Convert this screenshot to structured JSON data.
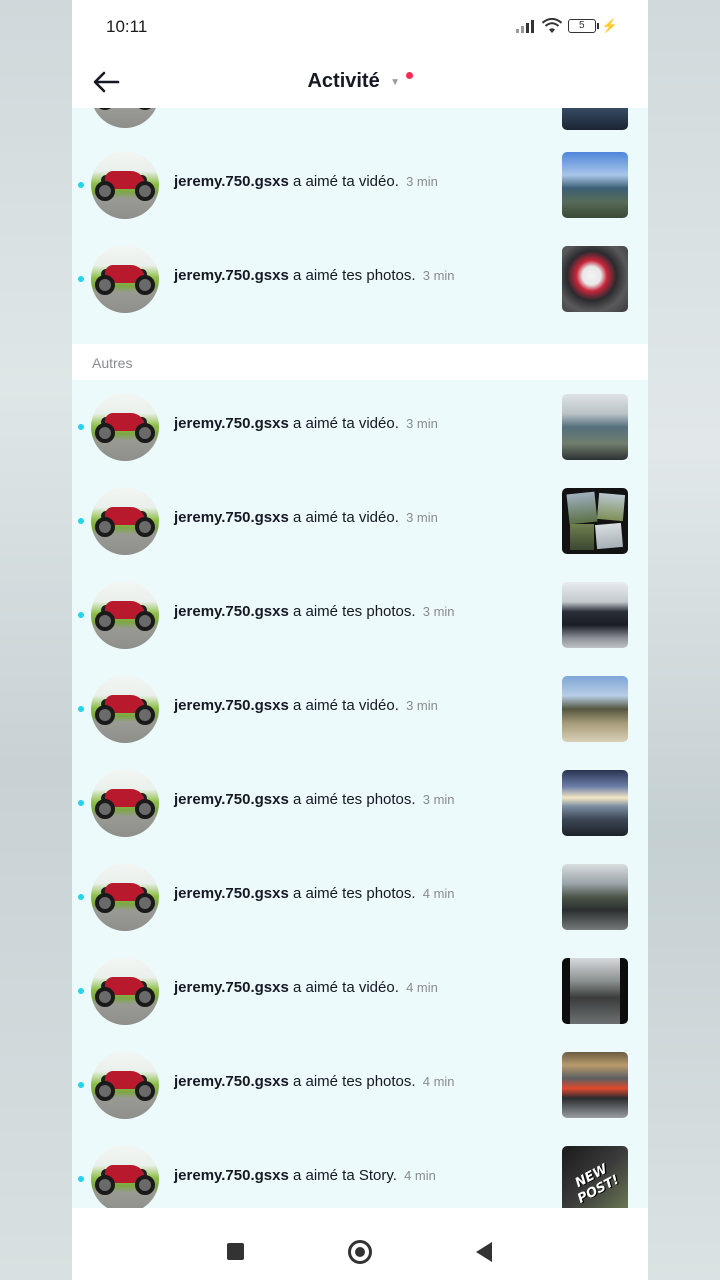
{
  "status_bar": {
    "time": "10:11",
    "battery": "5"
  },
  "header": {
    "title": "Activité"
  },
  "colors": {
    "unread_dot": "#20d5ec",
    "notification_dot": "#fe2c55",
    "section_bg": "#ecfafc",
    "muted_text": "#8a8b91"
  },
  "top_rows": [
    {
      "user": "jeremy.750.gsxs",
      "action": "a aimé ta vidéo.",
      "time": "3 min",
      "thumb": "lake-scene"
    },
    {
      "user": "jeremy.750.gsxs",
      "action": "a aimé tes photos.",
      "time": "3 min",
      "thumb": "white-motorcycle"
    }
  ],
  "section_label": "Autres",
  "other_rows": [
    {
      "user": "jeremy.750.gsxs",
      "action": "a aimé ta vidéo.",
      "time": "3 min",
      "thumb": "river-bike"
    },
    {
      "user": "jeremy.750.gsxs",
      "action": "a aimé ta vidéo.",
      "time": "3 min",
      "thumb": "collage"
    },
    {
      "user": "jeremy.750.gsxs",
      "action": "a aimé tes photos.",
      "time": "3 min",
      "thumb": "dark-car"
    },
    {
      "user": "jeremy.750.gsxs",
      "action": "a aimé ta vidéo.",
      "time": "3 min",
      "thumb": "field-bike"
    },
    {
      "user": "jeremy.750.gsxs",
      "action": "a aimé tes photos.",
      "time": "3 min",
      "thumb": "sunset-water"
    },
    {
      "user": "jeremy.750.gsxs",
      "action": "a aimé tes photos.",
      "time": "4 min",
      "thumb": "road-trees"
    },
    {
      "user": "jeremy.750.gsxs",
      "action": "a aimé ta vidéo.",
      "time": "4 min",
      "thumb": "dark-road"
    },
    {
      "user": "jeremy.750.gsxs",
      "action": "a aimé tes photos.",
      "time": "4 min",
      "thumb": "garage-bike"
    },
    {
      "user": "jeremy.750.gsxs",
      "action": "a aimé ta Story.",
      "time": "4 min",
      "thumb": "new-post",
      "thumb_text": "NEW POST!"
    }
  ]
}
